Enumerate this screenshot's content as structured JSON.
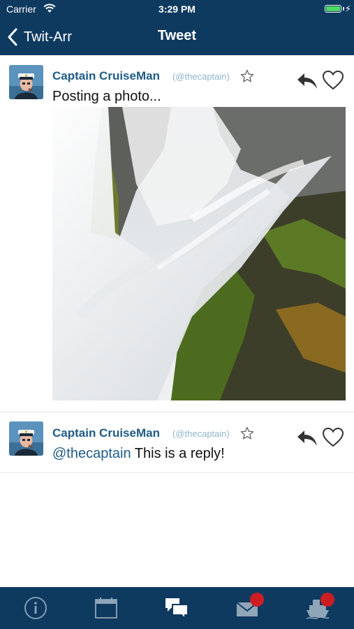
{
  "status_bar": {
    "carrier": "Carrier",
    "time": "3:29 PM",
    "battery_level": 1.0,
    "battery_color": "#4cd964"
  },
  "nav": {
    "back_label": "Twit-Arr",
    "title": "Tweet"
  },
  "tweets": [
    {
      "author": "Captain CruiseMan",
      "handle": "(@thecaptain)",
      "text": "Posting a photo...",
      "has_photo": true
    },
    {
      "author": "Captain CruiseMan",
      "handle": "(@thecaptain)",
      "mention": "@thecaptain",
      "text": " This is a reply!",
      "has_photo": false
    }
  ],
  "tabs": [
    {
      "icon": "info-icon",
      "badge": false
    },
    {
      "icon": "calendar-icon",
      "badge": false
    },
    {
      "icon": "chat-bubbles-icon",
      "badge": false,
      "selected": true
    },
    {
      "icon": "mail-icon",
      "badge": true
    },
    {
      "icon": "ship-icon",
      "badge": true
    }
  ],
  "colors": {
    "bar_background": "#0f3a60",
    "author": "#1f5c86",
    "handle": "#8fb5cc",
    "badge": "#cc1d25"
  }
}
